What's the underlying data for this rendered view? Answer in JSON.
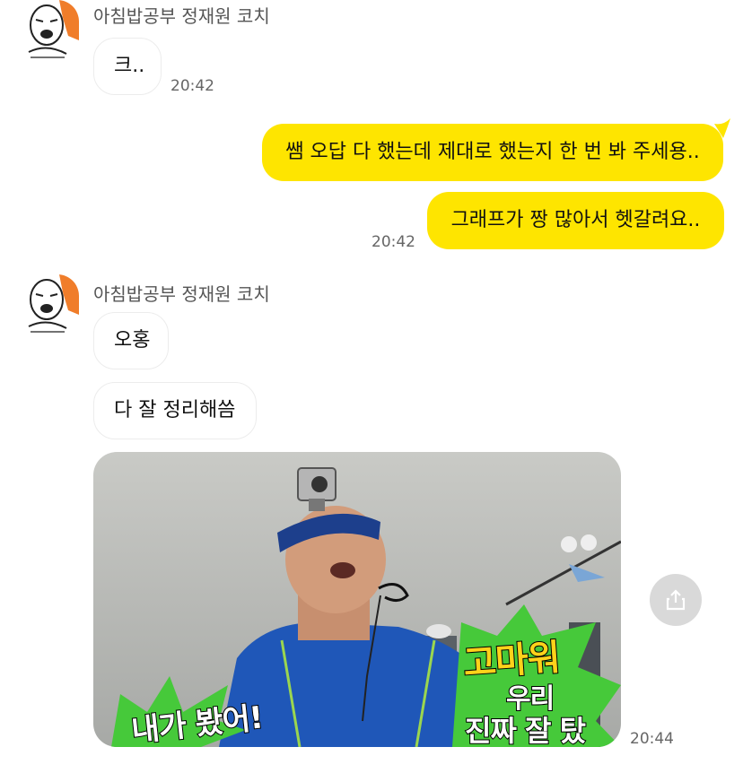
{
  "chat": {
    "sender_name": "아침밥공부 정재원 코치",
    "group1": {
      "msg1": "크..",
      "time1": "20:42"
    },
    "mine": {
      "msg1": "쌤 오답 다 했는데 제대로 했는지 한 번 봐 주세용..",
      "msg2": "그래프가 짱 많아서 헷갈려요..",
      "time": "20:42"
    },
    "group2": {
      "msg1": "오홍",
      "msg2": "다 잘 정리해씀",
      "image_caption_left": "내가 봤어!",
      "image_caption_right_1": "고마워",
      "image_caption_right_2": "우리",
      "image_caption_right_3": "진짜 잘 탔어!",
      "time": "20:44"
    }
  },
  "icons": {
    "share": "share-icon",
    "avatar": "avatar-cartoon"
  },
  "colors": {
    "my_bubble": "#FEE500",
    "their_bubble": "#FFFFFF",
    "background": "#FFFFFF"
  }
}
